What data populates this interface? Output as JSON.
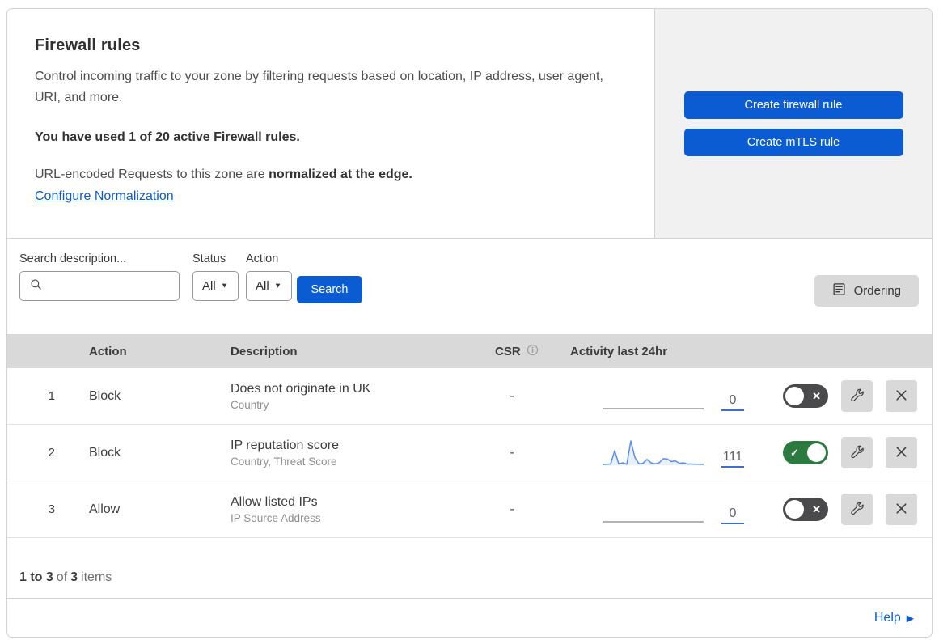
{
  "header": {
    "title": "Firewall rules",
    "description": "Control incoming traffic to your zone by filtering requests based on location, IP address, user agent, URI, and more.",
    "usage": "You have used 1 of 20 active Firewall rules.",
    "normalization_text": "URL-encoded Requests to this zone are ",
    "normalization_bold": "normalized at the edge.",
    "normalization_link": "Configure Normalization",
    "create_firewall_button": "Create firewall rule",
    "create_mtls_button": "Create mTLS rule"
  },
  "filters": {
    "search_label": "Search description...",
    "status_label": "Status",
    "status_value": "All",
    "action_label": "Action",
    "action_value": "All",
    "search_button": "Search",
    "ordering_button": "Ordering"
  },
  "table": {
    "columns": {
      "action": "Action",
      "description": "Description",
      "csr": "CSR",
      "activity": "Activity last 24hr"
    },
    "rows": [
      {
        "priority": "1",
        "action": "Block",
        "description": "Does not originate in UK",
        "fields": "Country",
        "csr": "-",
        "activity_count": "0",
        "enabled": false,
        "sparkline": [
          0,
          0,
          0,
          0,
          0,
          0,
          0,
          0,
          0,
          0,
          0,
          0,
          0,
          0,
          0,
          0,
          0,
          0,
          0,
          0,
          0,
          0,
          0,
          0,
          0,
          0
        ]
      },
      {
        "priority": "2",
        "action": "Block",
        "description": "IP reputation score",
        "fields": "Country, Threat Score",
        "csr": "-",
        "activity_count": "111",
        "enabled": true,
        "sparkline": [
          3,
          4,
          5,
          60,
          6,
          10,
          4,
          100,
          32,
          6,
          8,
          24,
          10,
          6,
          10,
          27,
          26,
          15,
          18,
          8,
          10,
          5,
          5,
          4,
          4,
          4
        ]
      },
      {
        "priority": "3",
        "action": "Allow",
        "description": "Allow listed IPs",
        "fields": "IP Source Address",
        "csr": "-",
        "activity_count": "0",
        "enabled": false,
        "sparkline": [
          0,
          0,
          0,
          0,
          0,
          0,
          0,
          0,
          0,
          0,
          0,
          0,
          0,
          0,
          0,
          0,
          0,
          0,
          0,
          0,
          0,
          0,
          0,
          0,
          0,
          0
        ]
      }
    ]
  },
  "footer": {
    "range": "1 to 3",
    "of": "of",
    "total": "3",
    "items": "items",
    "help": "Help"
  },
  "icons": {
    "dropdown_caret": "▼",
    "toggle_on": "✓",
    "toggle_off": "✕",
    "help_arrow": "▶"
  },
  "colors": {
    "accent_blue": "#0b5bd3",
    "toggle_on_green": "#2b7a40",
    "toggle_off_gray": "#4a4a4c",
    "table_header_gray": "#d9d9d9",
    "panel_gray": "#f1f1f1",
    "sparkline": "#5b8def",
    "sparkline_flat": "#9a9a9a",
    "sparkline_fill": "rgba(91,141,239,0.14)"
  }
}
